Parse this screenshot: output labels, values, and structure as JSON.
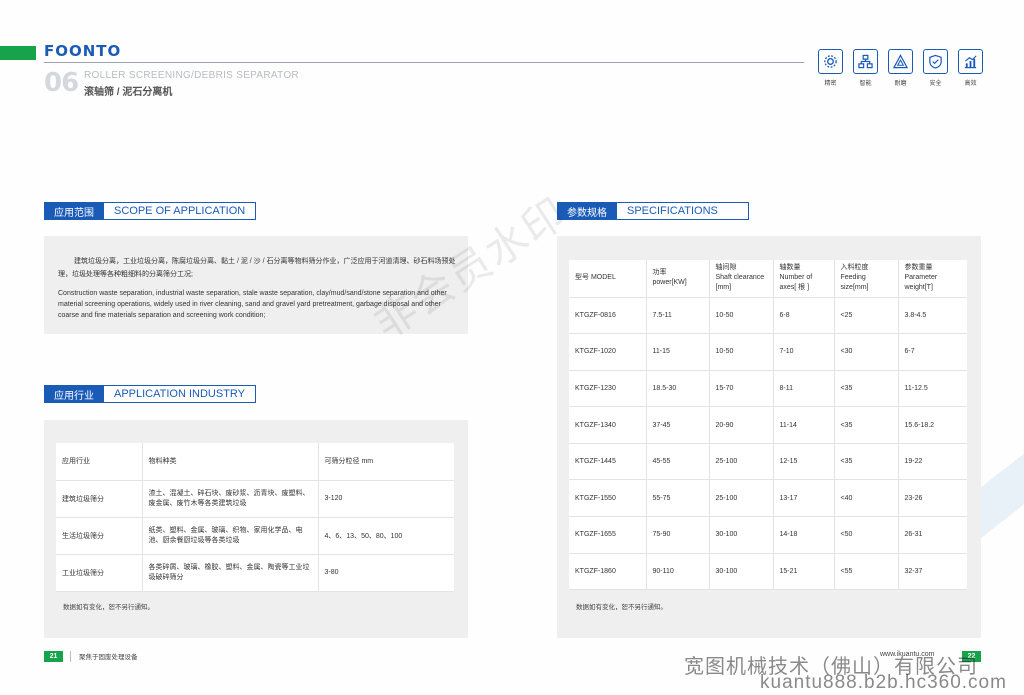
{
  "brand": "FOONTO",
  "section": {
    "number": "06",
    "title_en": "ROLLER SCREENING/DEBRIS SEPARATOR",
    "title_cn": "滚轴筛 / 泥石分离机"
  },
  "features": [
    {
      "icon": "gear-icon",
      "label": "精密"
    },
    {
      "icon": "network-icon",
      "label": "智能"
    },
    {
      "icon": "triangle-icon",
      "label": "耐磨"
    },
    {
      "icon": "shield-icon",
      "label": "安全"
    },
    {
      "icon": "chart-icon",
      "label": "高效"
    }
  ],
  "scope": {
    "header_cn": "应用范围",
    "header_en": "SCOPE OF APPLICATION",
    "text_cn": "建筑垃圾分离，工业垃圾分离，陈腐垃圾分离、黏土 / 泥 / 沙 / 石分离等物料筛分作业，广泛应用于河道清理、砂石料场预处理，垃圾处理等各种粗细料的分离筛分工况;",
    "text_en": "Construction waste separation, industrial waste separation, stale waste separation, clay/mud/sand/stone separation and other material screening operations, widely used in river cleaning, sand and gravel yard pretreatment, garbage disposal and other coarse and fine materials separation and screening work condition;"
  },
  "industry": {
    "header_cn": "应用行业",
    "header_en": "APPLICATION INDUSTRY",
    "columns": [
      "应用行业",
      "物料种类",
      "可筛分粒径 mm"
    ],
    "rows": [
      [
        "建筑垃圾筛分",
        "渣土、混凝土、碎石块、废砂浆、沥青块、废塑料、废金属、废竹木等各类建筑垃圾",
        "3-120"
      ],
      [
        "生活垃圾筛分",
        "纸类、塑料、金属、玻璃、织物、家用化学品、电池、厨余餐厨垃圾等各类垃圾",
        "4、6、13、50、80、100"
      ],
      [
        "工业垃圾筛分",
        "各类碎屑、玻璃、橡胶、塑料、金属、陶瓷等工业垃圾破碎筛分",
        "3-80"
      ]
    ],
    "note": "数据如有变化，恕不另行通知。"
  },
  "specs": {
    "header_cn": "参数规格",
    "header_en": "SPECIFICATIONS",
    "columns": [
      [
        "型号 MODEL"
      ],
      [
        "功率",
        "power[KW]"
      ],
      [
        "轴间隙",
        "Shaft clearance",
        "[mm]"
      ],
      [
        "轴数量",
        "Number of",
        "axes[ 根 ]"
      ],
      [
        "入料粒度",
        "Feeding",
        "size[mm]"
      ],
      [
        "参数重量",
        "Parameter",
        "weight[T]"
      ]
    ],
    "rows": [
      [
        "KTGZF-0816",
        "7.5-11",
        "10-50",
        "6-8",
        "<25",
        "3.8-4.5"
      ],
      [
        "KTGZF-1020",
        "11-15",
        "10-50",
        "7-10",
        "<30",
        "6-7"
      ],
      [
        "KTGZF-1230",
        "18.5-30",
        "15-70",
        "8-11",
        "<35",
        "11-12.5"
      ],
      [
        "KTGZF-1340",
        "37-45",
        "20-90",
        "11-14",
        "<35",
        "15.6-18.2"
      ],
      [
        "KTGZF-1445",
        "45-55",
        "25-100",
        "12-15",
        "<35",
        "19-22"
      ],
      [
        "KTGZF-1550",
        "55-75",
        "25-100",
        "13-17",
        "<40",
        "23-26"
      ],
      [
        "KTGZF-1655",
        "75-90",
        "30-100",
        "14-18",
        "<50",
        "26-31"
      ],
      [
        "KTGZF-1860",
        "90-110",
        "30-100",
        "15-21",
        "<55",
        "32-37"
      ]
    ],
    "note": "数据如有变化，恕不另行通知。"
  },
  "footer": {
    "page_left": "21",
    "slogan": "聚焦于固废处理设备",
    "url": "www.ikuantu.com",
    "page_right": "22"
  },
  "watermarks": {
    "center": "非会员水印",
    "company": "宽图机械技术（佛山）有限公司",
    "site": "kuantu888.b2b.hc360.com"
  },
  "colors": {
    "brand_blue": "#1a5bb8",
    "accent_green": "#16a34a",
    "panel_gray": "#efefef"
  }
}
